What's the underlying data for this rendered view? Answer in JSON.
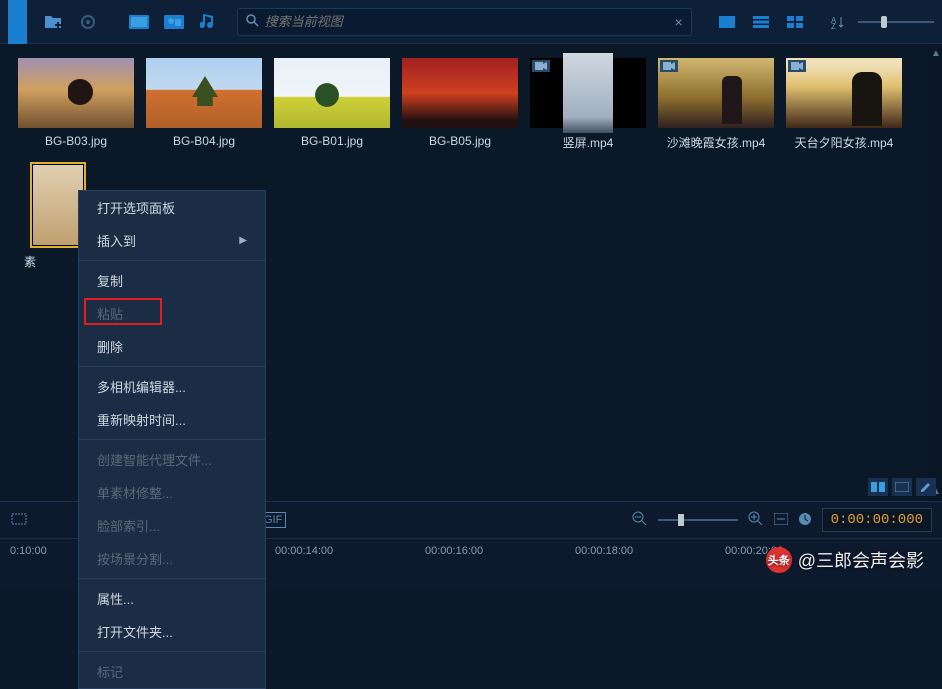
{
  "toolbar": {
    "search_placeholder": "搜索当前视图"
  },
  "media": [
    {
      "name": "BG-B03.jpg",
      "type": "image",
      "thumb_class": "t-b03"
    },
    {
      "name": "BG-B04.jpg",
      "type": "image",
      "thumb_class": "t-b04"
    },
    {
      "name": "BG-B01.jpg",
      "type": "image",
      "thumb_class": "t-b01"
    },
    {
      "name": "BG-B05.jpg",
      "type": "image",
      "thumb_class": "t-b05"
    },
    {
      "name": "竖屏.mp4",
      "type": "video",
      "thumb_class": "t-v1"
    },
    {
      "name": "沙滩晚霞女孩.mp4",
      "type": "video",
      "thumb_class": "t-v2"
    },
    {
      "name": "天台夕阳女孩.mp4",
      "type": "video",
      "thumb_class": "t-v3"
    }
  ],
  "selected": {
    "name": "素",
    "thumb_class": "t-sel"
  },
  "context_menu": {
    "open_options": "打开选项面板",
    "insert_to": "插入到",
    "copy": "复制",
    "paste": "粘贴",
    "delete": "删除",
    "multicam": "多相机编辑器...",
    "remap_time": "重新映射时间...",
    "create_proxy": "创建智能代理文件...",
    "single_trim": "单素材修整...",
    "face_index": "脸部索引...",
    "scene_split": "按场景分割...",
    "properties": "属性...",
    "open_folder": "打开文件夹...",
    "marker": "标记"
  },
  "timeline": {
    "timecode": "0:00:00:000",
    "ticks": [
      "0:10:00",
      "00:00:14:00",
      "00:00:16:00",
      "00:00:18:00",
      "00:00:20:00"
    ]
  },
  "watermark": "@三郎会声会影",
  "watermark_logo": "头条"
}
